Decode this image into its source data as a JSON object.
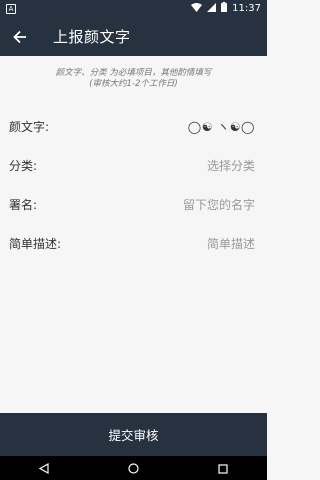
{
  "status_bar": {
    "time": "11:37",
    "notification_letter": "A"
  },
  "app_bar": {
    "title": "上报颜文字"
  },
  "notice": {
    "line1": "颜文字、分类 为必填项目，其他酌情填写",
    "line2": "(审核大约1-2个工作日)"
  },
  "form": {
    "kaomoji": {
      "label": "颜文字:",
      "value": "◯☯ ヽ☯◯"
    },
    "category": {
      "label": "分类:",
      "placeholder": "选择分类"
    },
    "signature": {
      "label": "署名:",
      "placeholder": "留下您的名字"
    },
    "description": {
      "label": "简单描述:",
      "placeholder": "简单描述"
    }
  },
  "submit": {
    "label": "提交审核"
  }
}
